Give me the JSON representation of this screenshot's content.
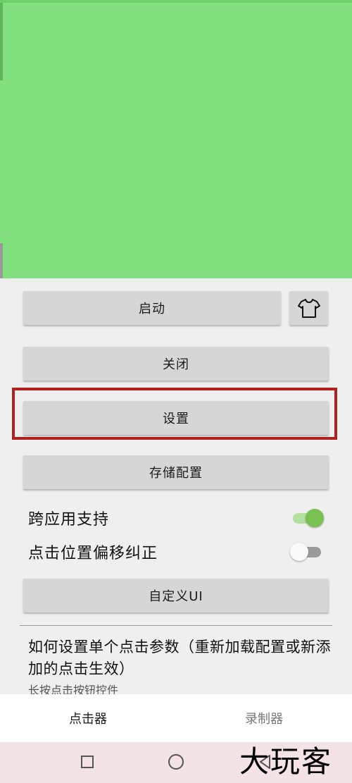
{
  "buttons": {
    "start": "启动",
    "close": "关闭",
    "settings": "设置",
    "save_config": "存储配置",
    "custom_ui": "自定义UI"
  },
  "toggles": {
    "cross_app": {
      "label": "跨应用支持",
      "state": "on"
    },
    "click_offset": {
      "label": "点击位置偏移纠正",
      "state": "off"
    }
  },
  "help": {
    "title": "如何设置单个点击参数（重新加载配置或新添加的点击生效）",
    "subtitle": "长按点击按钮控件"
  },
  "bottom_nav": {
    "tabs": [
      {
        "label": "点击器",
        "active": true
      },
      {
        "label": "录制器",
        "active": false
      }
    ]
  },
  "watermark": "大玩客",
  "colors": {
    "banner": "#82e07e",
    "highlight_border": "#b0221c",
    "toggle_on": "#7ac053"
  },
  "icons": {
    "theme": "shirt-icon",
    "home": "home-circle-icon",
    "recents": "recents-square-icon",
    "back": "back-triangle-icon"
  }
}
